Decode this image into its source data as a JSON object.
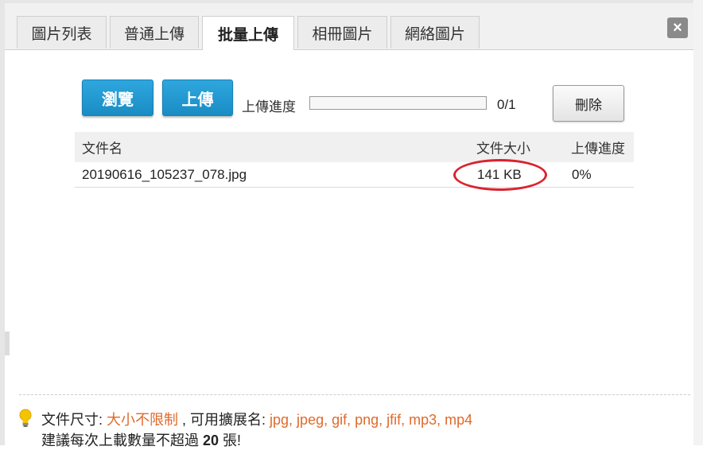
{
  "tabs": [
    {
      "label": "圖片列表"
    },
    {
      "label": "普通上傳"
    },
    {
      "label": "批量上傳",
      "active": true
    },
    {
      "label": "相冊圖片"
    },
    {
      "label": "網絡圖片"
    }
  ],
  "close_label": "×",
  "toolbar": {
    "browse_label": "瀏覽",
    "upload_label": "上傳",
    "progress_label": "上傳進度",
    "progress_fraction": 0,
    "count": "0/1",
    "delete_label": "刪除"
  },
  "table": {
    "headers": {
      "name": "文件名",
      "size": "文件大小",
      "progress": "上傳進度"
    },
    "rows": [
      {
        "name": "20190616_105237_078.jpg",
        "size": "141 KB",
        "progress": "0%"
      }
    ]
  },
  "hints": {
    "size_label": "文件尺寸: ",
    "size_value": "大小不限制",
    "ext_label": " , 可用擴展名: ",
    "ext_value": "jpg, jpeg, gif, png, jfif, mp3, mp4",
    "line2_prefix": "建議每次上載數量不超過 ",
    "line2_number": "20",
    "line2_suffix": " 張!"
  },
  "colors": {
    "accent_blue": "#1a8cc4",
    "highlight_red": "#d9232e",
    "hint_orange": "#e06a2b"
  },
  "icons": {
    "close": "close-icon",
    "hint": "lightbulb-icon"
  }
}
